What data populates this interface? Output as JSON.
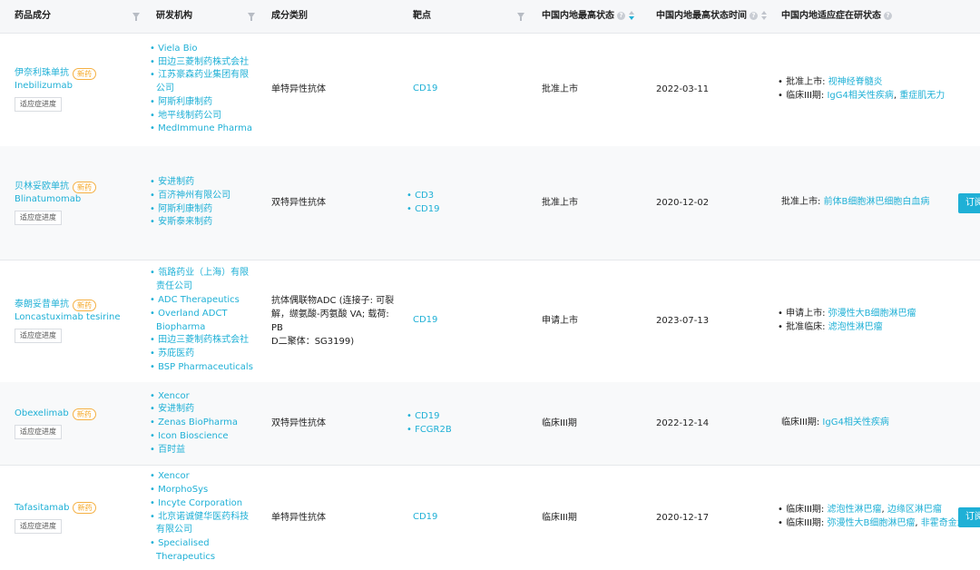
{
  "headers": {
    "drug": "药品成分",
    "org": "研发机构",
    "category": "成分类别",
    "target": "靶点",
    "status": "中国内地最高状态",
    "time": "中国内地最高状态时间",
    "indication": "中国内地适应症在研状态"
  },
  "progress_label": "适应症进度",
  "subscribe_label": "订阅",
  "rows": [
    {
      "name_cn": "伊奈利珠单抗",
      "badge": "新药",
      "name_en": "Inebilizumab",
      "orgs": [
        "Viela Bio",
        "田边三菱制药株式会社",
        "江苏豪森药业集团有限",
        "公司",
        "阿斯利康制药",
        "地平线制药公司",
        "MedImmune Pharma"
      ],
      "category": "单特异性抗体",
      "targets": [
        "CD19"
      ],
      "status": "批准上市",
      "time": "2022-03-11",
      "indications": [
        {
          "label": "批准上市:",
          "items": [
            "视神经脊髓炎"
          ]
        },
        {
          "label": "临床III期:",
          "items": [
            "IgG4相关性疾病",
            "重症肌无力"
          ]
        }
      ]
    },
    {
      "name_cn": "贝林妥欧单抗",
      "badge": "新药",
      "name_en": "Blinatumomab",
      "orgs": [
        "安进制药",
        "百济神州有限公司",
        "阿斯利康制药",
        "安斯泰来制药"
      ],
      "category": "双特异性抗体",
      "targets": [
        "CD3",
        "CD19"
      ],
      "status": "批准上市",
      "time": "2020-12-02",
      "indications": [
        {
          "label": "批准上市:",
          "items": [
            "前体B细胞淋巴细胞白血病"
          ]
        }
      ]
    },
    {
      "name_cn": "泰朗妥昔单抗",
      "badge": "新药",
      "name_en": "Loncastuximab tesirine",
      "orgs": [
        "瓴路药业（上海）有限",
        "责任公司",
        "ADC Therapeutics",
        "Overland ADCT",
        "Biopharma",
        "田边三菱制药株式会社",
        "苏庇医药",
        "BSP Pharmaceuticals"
      ],
      "category_lines": [
        "抗体偶联物ADC (连接子: 可裂",
        "解，缬氨酸-丙氨酸 VA; 载荷: PB",
        "D二聚体：SG3199)"
      ],
      "targets": [
        "CD19"
      ],
      "status": "申请上市",
      "time": "2023-07-13",
      "indications": [
        {
          "label": "申请上市:",
          "items": [
            "弥漫性大B细胞淋巴瘤"
          ]
        },
        {
          "label": "批准临床:",
          "items": [
            "滤泡性淋巴瘤"
          ]
        }
      ]
    },
    {
      "name_cn": "Obexelimab",
      "badge": "新药",
      "name_en": "",
      "orgs": [
        "Xencor",
        "安进制药",
        "Zenas BioPharma",
        "Icon Bioscience",
        "百时益"
      ],
      "category": "双特异性抗体",
      "targets": [
        "CD19",
        "FCGR2B"
      ],
      "status": "临床III期",
      "time": "2022-12-14",
      "indications": [
        {
          "label": "临床III期:",
          "items": [
            "IgG4相关性疾病"
          ]
        }
      ]
    },
    {
      "name_cn": "Tafasitamab",
      "badge": "新药",
      "name_en": "",
      "orgs": [
        "Xencor",
        "MorphoSys",
        "Incyte Corporation",
        "北京诺诚健华医药科技",
        "有限公司",
        "Specialised",
        "Therapeutics"
      ],
      "category": "单特异性抗体",
      "targets": [
        "CD19"
      ],
      "status": "临床III期",
      "time": "2020-12-17",
      "indications": [
        {
          "label": "临床III期:",
          "items": [
            "滤泡性淋巴瘤",
            "边缘区淋巴瘤"
          ]
        },
        {
          "label": "临床III期:",
          "items": [
            "弥漫性大B细胞淋巴瘤",
            "非霍奇金淋"
          ]
        }
      ]
    }
  ],
  "colors": {
    "link": "#1fb0d6",
    "badge": "#f5a623",
    "header_bg": "#f6f7f9",
    "alt_row": "#f8f9fa"
  }
}
